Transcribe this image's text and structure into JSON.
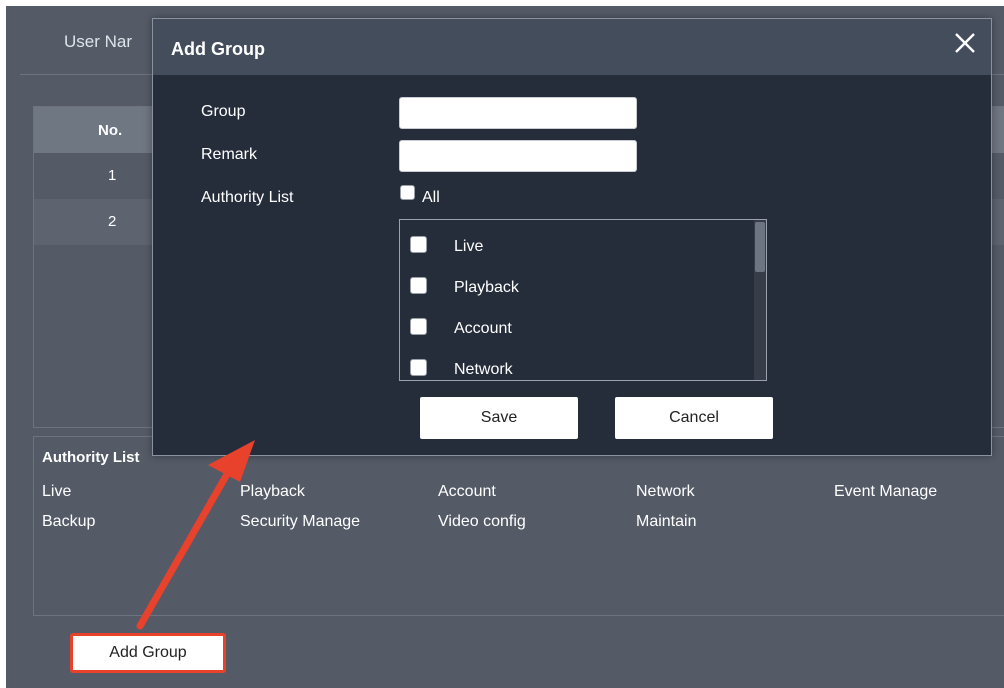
{
  "background": {
    "header_text": "User Nar",
    "table": {
      "column_no": "No.",
      "rows": [
        "1",
        "2"
      ]
    },
    "authority_panel": {
      "title": "Authority List",
      "items": [
        "Live",
        "Playback",
        "Account",
        "Network",
        "Event Manage",
        "Backup",
        "Security Manage",
        "Video config",
        "Maintain"
      ]
    },
    "add_group_button": "Add Group"
  },
  "dialog": {
    "title": "Add Group",
    "close_icon": "close-icon",
    "group_label": "Group",
    "group_value": "",
    "remark_label": "Remark",
    "remark_value": "",
    "authority_label": "Authority List",
    "all_label": "All",
    "authority_items": [
      {
        "label": "Live",
        "checked": false
      },
      {
        "label": "Playback",
        "checked": false
      },
      {
        "label": "Account",
        "checked": false
      },
      {
        "label": "Network",
        "checked": false
      }
    ],
    "save_label": "Save",
    "cancel_label": "Cancel"
  },
  "colors": {
    "page_bg": "#545b67",
    "dialog_bg": "#262d3a",
    "dialog_header": "#444d5c",
    "highlight": "#e8412c"
  }
}
